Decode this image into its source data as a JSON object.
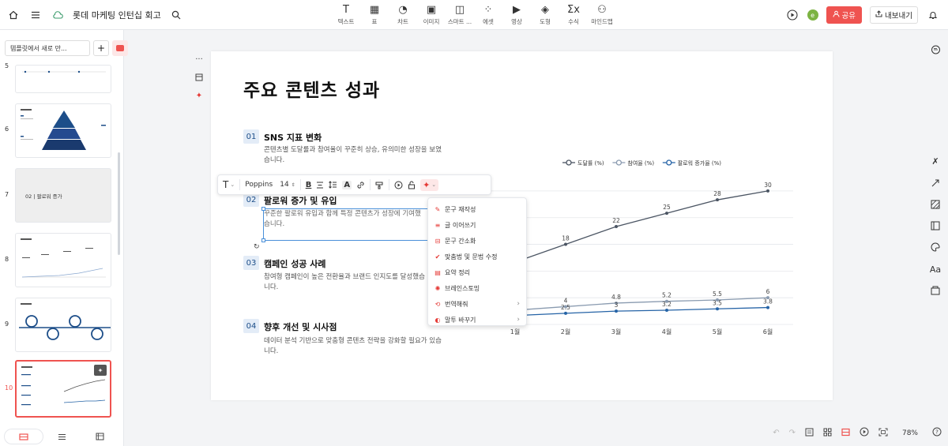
{
  "header": {
    "doc_title": "롯데 마케팅 인턴십 회고",
    "tools": [
      {
        "label": "텍스트",
        "icon": "T"
      },
      {
        "label": "표",
        "icon": "▦"
      },
      {
        "label": "차트",
        "icon": "◔"
      },
      {
        "label": "이미지",
        "icon": "▣"
      },
      {
        "label": "스마트 ...",
        "icon": "◫"
      },
      {
        "label": "에셋",
        "icon": "⁘"
      },
      {
        "label": "영상",
        "icon": "▶"
      },
      {
        "label": "도형",
        "icon": "◈"
      },
      {
        "label": "수식",
        "icon": "Σx"
      },
      {
        "label": "마인드맵",
        "icon": "⚇"
      }
    ],
    "share_label": "공유",
    "export_label": "내보내기",
    "avatar_initial": "e"
  },
  "left_panel": {
    "template_input": "템플릿에서 새로 만...",
    "thumbnails": [
      {
        "num": "5"
      },
      {
        "num": "6"
      },
      {
        "num": "7",
        "title": "02 | 팔로워 증가"
      },
      {
        "num": "8"
      },
      {
        "num": "9"
      },
      {
        "num": "10"
      }
    ]
  },
  "slide": {
    "title": "주요 콘텐츠 성과",
    "items": [
      {
        "num": "01",
        "title": "SNS 지표 변화",
        "desc": "콘텐츠별 도달률과 참여율이 꾸준히 상승, 유의미한 성장을 보였습니다."
      },
      {
        "num": "02",
        "title": "팔로워 증가 및 유입",
        "desc": "꾸준한 팔로워 유입과 함께 특정 콘텐츠가 성장에 기여했습니다."
      },
      {
        "num": "03",
        "title": "캠페인 성공 사례",
        "desc": "참여형 캠페인이 높은 전환율과 브랜드 인지도를 달성했습니다."
      },
      {
        "num": "04",
        "title": "향후 개선 및 시사점",
        "desc": "데이터 분석 기반으로 맞춤형 콘텐츠 전략을 강화할 필요가 있습니다."
      }
    ]
  },
  "float_toolbar": {
    "font": "Poppins",
    "size": "14"
  },
  "ai_menu": {
    "items": [
      {
        "label": "문구 재작성",
        "icon": "✎"
      },
      {
        "label": "글 이어쓰기",
        "icon": "≡"
      },
      {
        "label": "문구 간소화",
        "icon": "⊟"
      },
      {
        "label": "맞춤법 및 문법 수정",
        "icon": "✔"
      },
      {
        "label": "요약 정리",
        "icon": "▤"
      },
      {
        "label": "브레인스토밍",
        "icon": "✺"
      },
      {
        "label": "번역해줘",
        "icon": "⟲",
        "submenu": true
      },
      {
        "label": "말투 바꾸기",
        "icon": "◐",
        "submenu": true
      }
    ]
  },
  "bottom": {
    "zoom": "78%"
  },
  "chart_data": {
    "type": "line",
    "categories": [
      "1월",
      "2월",
      "3월",
      "4월",
      "5월",
      "6월"
    ],
    "series": [
      {
        "name": "도달률 (%)",
        "color": "#4b5563",
        "values": [
          null,
          18,
          22,
          25,
          28,
          30
        ]
      },
      {
        "name": "참여율 (%)",
        "color": "#8a9bb0",
        "values": [
          null,
          4,
          4.8,
          5.2,
          5.5,
          6
        ]
      },
      {
        "name": "팔로워 증가율 (%)",
        "color": "#2563a6",
        "values": [
          null,
          2.5,
          3,
          3.2,
          3.5,
          3.8
        ]
      }
    ],
    "data_labels": [
      {
        "series": 0,
        "values": [
          "",
          "18",
          "22",
          "25",
          "28",
          "30"
        ]
      },
      {
        "series": 1,
        "values": [
          "",
          "4",
          "4.8",
          "5.2",
          "5.5",
          "6"
        ]
      },
      {
        "series": 2,
        "values": [
          "",
          "2.5",
          "3",
          "3.2",
          "3.5",
          "3.8"
        ]
      }
    ],
    "legend_position": "top",
    "grid": true
  }
}
